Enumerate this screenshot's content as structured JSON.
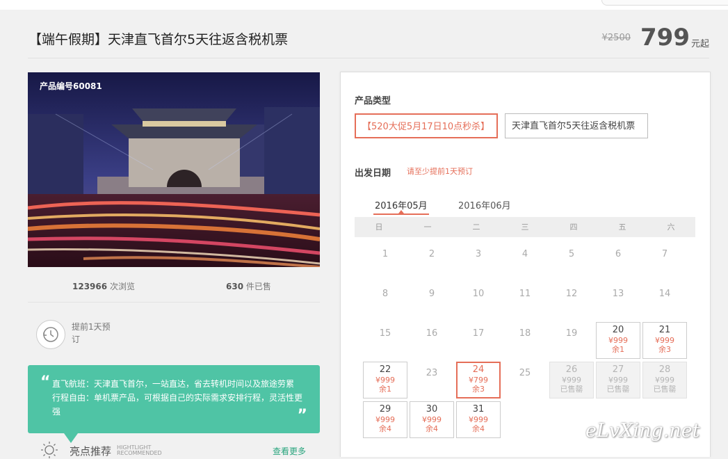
{
  "title": "【端午假期】天津直飞首尔5天往返含税机票",
  "price": {
    "original": "¥2500",
    "current": "799",
    "unit": "元起"
  },
  "product_id": "产品编号60081",
  "stats": {
    "views_num": "123966",
    "views_label": "次浏览",
    "sold_num": "630",
    "sold_label": "件已售"
  },
  "advance": "提前1天预订",
  "note": {
    "text": "直飞航班：天津直飞首尔，一站直达，省去转机时间以及旅途劳累 行程自由：单机票产品，可根据自己的实际需求安排行程，灵活性更强",
    "open_quote": "“",
    "close_quote": "”"
  },
  "highlight": {
    "title": "亮点推荐",
    "en1": "HIGHTLIGHT",
    "en2": "RECOMMENDED",
    "more": "查看更多"
  },
  "product_type": {
    "label": "产品类型",
    "options": [
      "【520大促5月17日10点秒杀】",
      "天津直飞首尔5天往返含税机票"
    ]
  },
  "departure": {
    "label": "出发日期",
    "hint": "请至少提前1天预订"
  },
  "months": [
    "2016年05月",
    "2016年06月"
  ],
  "weekdays": [
    "日",
    "一",
    "二",
    "三",
    "四",
    "五",
    "六"
  ],
  "days": [
    {
      "d": "1"
    },
    {
      "d": "2"
    },
    {
      "d": "3"
    },
    {
      "d": "4"
    },
    {
      "d": "5"
    },
    {
      "d": "6"
    },
    {
      "d": "7"
    },
    {
      "d": "8"
    },
    {
      "d": "9"
    },
    {
      "d": "10"
    },
    {
      "d": "11"
    },
    {
      "d": "12"
    },
    {
      "d": "13"
    },
    {
      "d": "14"
    },
    {
      "d": "15"
    },
    {
      "d": "16"
    },
    {
      "d": "17"
    },
    {
      "d": "18"
    },
    {
      "d": "19"
    },
    {
      "d": "20",
      "price": "¥999",
      "remain": "余1",
      "state": "avail"
    },
    {
      "d": "21",
      "price": "¥999",
      "remain": "余3",
      "state": "avail"
    },
    {
      "d": "22",
      "price": "¥999",
      "remain": "余1",
      "state": "avail"
    },
    {
      "d": "23"
    },
    {
      "d": "24",
      "price": "¥799",
      "remain": "余3",
      "state": "selected"
    },
    {
      "d": "25"
    },
    {
      "d": "26",
      "price": "¥999",
      "remain": "已售罄",
      "state": "sold"
    },
    {
      "d": "27",
      "price": "¥999",
      "remain": "已售罄",
      "state": "sold"
    },
    {
      "d": "28",
      "price": "¥999",
      "remain": "已售罄",
      "state": "sold"
    },
    {
      "d": "29",
      "price": "¥999",
      "remain": "余4",
      "state": "avail"
    },
    {
      "d": "30",
      "price": "¥999",
      "remain": "余4",
      "state": "avail"
    },
    {
      "d": "31",
      "price": "¥999",
      "remain": "余4",
      "state": "avail"
    }
  ],
  "watermark": "eLvXing.net",
  "colors": {
    "accent": "#e56e58",
    "green": "#4fc4a5",
    "link": "#2aa57e"
  }
}
